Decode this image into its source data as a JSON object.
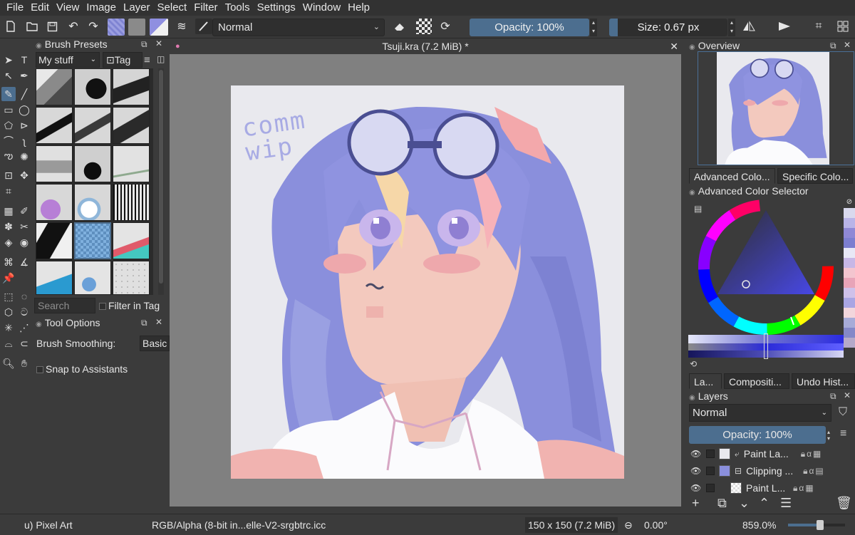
{
  "menu": [
    "File",
    "Edit",
    "View",
    "Image",
    "Layer",
    "Select",
    "Filter",
    "Tools",
    "Settings",
    "Window",
    "Help"
  ],
  "toolbar": {
    "blend_mode": "Normal",
    "opacity": "Opacity: 100%",
    "size": "Size: 0.67 px"
  },
  "brush_presets": {
    "title": "Brush Presets",
    "filter": "My stuff",
    "tag_button": "Tag",
    "search_placeholder": "Search",
    "filter_in_tag": "Filter in Tag"
  },
  "tool_options": {
    "title": "Tool Options",
    "smoothing_label": "Brush Smoothing:",
    "smoothing_value": "Basic",
    "snap_label": "Snap to Assistants"
  },
  "document": {
    "tab_title": "Tsuji.kra (7.2 MiB) *",
    "artwork_text": "comm wip"
  },
  "overview": {
    "title": "Overview"
  },
  "color_tabs": [
    "Advanced Colo...",
    "Specific Colo..."
  ],
  "color_selector": {
    "title": "Advanced Color Selector"
  },
  "color_strip": [
    "#d9d9ee",
    "#b9b4e8",
    "#8f88d6",
    "#7c7ed0",
    "#e8e8f6",
    "#c7b7e6",
    "#f3c5cf",
    "#e8a4b8",
    "#cfc1ea",
    "#a9a5e3",
    "#f2d6dc",
    "#a7abd8",
    "#8488c8",
    "#b5a9c9"
  ],
  "layer_tabs": [
    "La...",
    "Compositi...",
    "Undo Hist..."
  ],
  "layers": {
    "title": "Layers",
    "blend_mode": "Normal",
    "opacity": "Opacity:  100%",
    "items": [
      {
        "name": "Paint La..."
      },
      {
        "name": "Clipping ..."
      },
      {
        "name": "Paint L..."
      }
    ]
  },
  "status": {
    "tool": "u) Pixel Art",
    "color_profile": "RGB/Alpha (8-bit in...elle-V2-srgbtrc.icc",
    "image_size": "150 x 150 (7.2 MiB)",
    "rotation": "0.00°",
    "zoom": "859.0%"
  },
  "colors": {
    "accent": "#4c6e8f",
    "panel": "#3b3b3b",
    "canvas_bg": "#808080",
    "hair": "#8a8fdc",
    "skin": "#f3c9be",
    "blush": "#eea8ac"
  }
}
